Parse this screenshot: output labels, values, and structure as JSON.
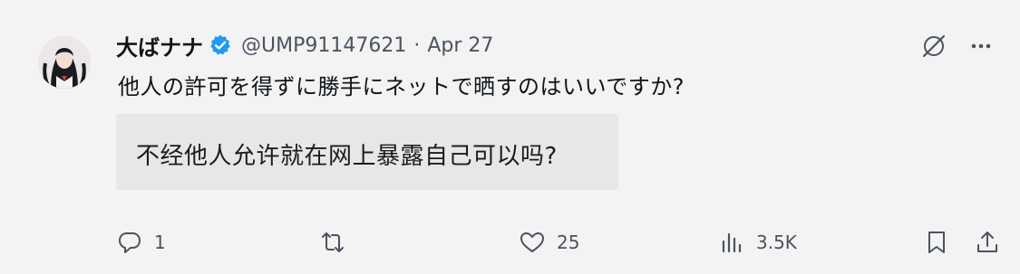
{
  "tweet": {
    "author_name": "大ばナナ",
    "handle": "@UMP91147621",
    "separator": "·",
    "date": "Apr 27",
    "text": "他人の許可を得ずに勝手にネットで晒すのはいいですか?",
    "translation": "不经他人允许就在网上暴露自己可以吗?"
  },
  "actions": {
    "reply_count": "1",
    "retweet_count": "",
    "like_count": "25",
    "views_count": "3.5K"
  },
  "icons": {
    "verified": "verified-badge-icon",
    "grok": "grok-icon",
    "more": "more-icon",
    "reply": "reply-icon",
    "retweet": "retweet-icon",
    "like": "heart-icon",
    "views": "views-icon",
    "bookmark": "bookmark-icon",
    "share": "share-icon"
  },
  "colors": {
    "background": "#f3f3f3",
    "verified": "#1d9bf0",
    "muted": "#4b5360",
    "translation_bg": "#e9e6e6"
  }
}
